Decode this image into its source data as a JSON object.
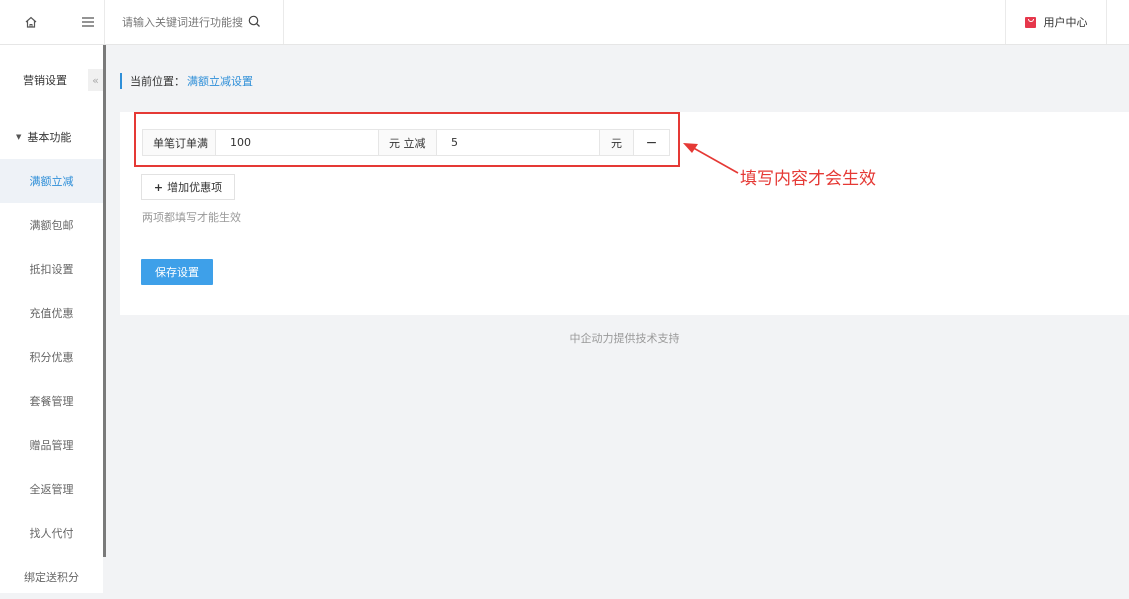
{
  "topbar": {
    "search_placeholder": "请输入关键词进行功能搜",
    "user_center": "用户中心"
  },
  "sidebar": {
    "title": "营销设置",
    "collapse_icon": "«",
    "group": "基本功能",
    "items": [
      {
        "label": "满额立减",
        "active": true
      },
      {
        "label": "满额包邮"
      },
      {
        "label": "抵扣设置"
      },
      {
        "label": "充值优惠"
      },
      {
        "label": "积分优惠"
      },
      {
        "label": "套餐管理"
      },
      {
        "label": "赠品管理"
      },
      {
        "label": "全返管理"
      },
      {
        "label": "找人代付"
      },
      {
        "label": "绑定送积分"
      }
    ]
  },
  "breadcrumb": {
    "label": "当前位置：",
    "current": "满额立减设置"
  },
  "rule": {
    "prefix_label": "单笔订单满",
    "amount_value": "100",
    "mid_label": "元 立减",
    "discount_value": "5",
    "unit_label": "元",
    "remove_symbol": "−"
  },
  "add_button": {
    "icon": "+",
    "label": "增加优惠项"
  },
  "hint": "两项都填写才能生效",
  "save_button": "保存设置",
  "footer": "中企动力提供技术支持",
  "annotation": {
    "text": "填写内容才会生效",
    "color": "#e53935"
  },
  "colors": {
    "accent": "#2f8fd8",
    "save_button_bg": "#3ea0e9",
    "user_icon": "#e6374b"
  }
}
